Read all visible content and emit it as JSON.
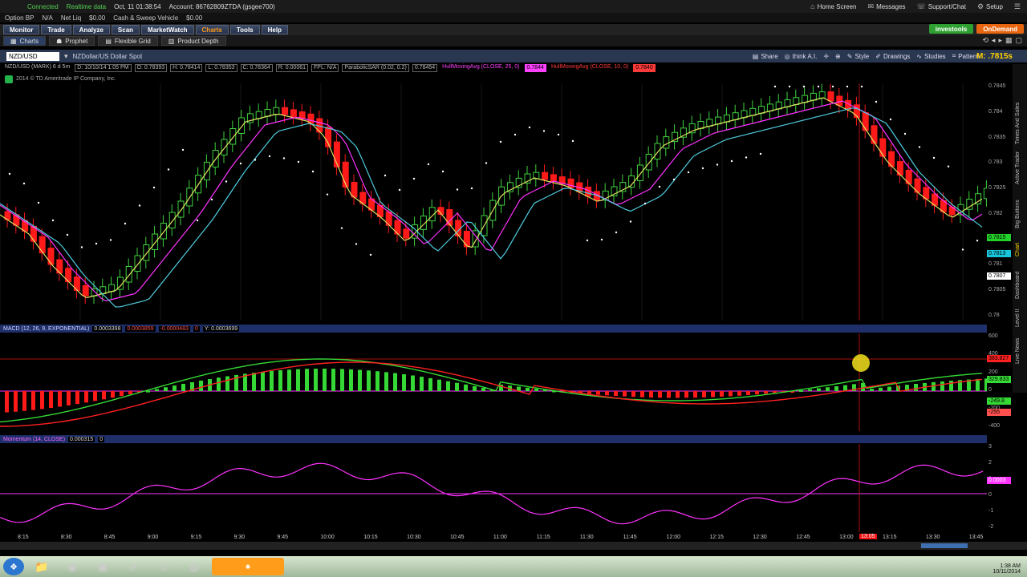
{
  "status": {
    "connected": "Connected",
    "realtime": "Realtime data",
    "datetime": "Oct, 11  01:38:54",
    "account": "Account: 86762809ZTDA (gsgee700)",
    "option_bp": "Option BP",
    "option_bp_val": "N/A",
    "net_liq": "Net Liq",
    "net_liq_val": "$0.00",
    "cash": "Cash & Sweep Vehicle",
    "cash_val": "$0.00"
  },
  "topright": {
    "home": "Home Screen",
    "messages": "Messages",
    "support": "Support/Chat",
    "setup": "Setup"
  },
  "menu": {
    "items": [
      "Monitor",
      "Trade",
      "Analyze",
      "Scan",
      "MarketWatch",
      "Charts",
      "Tools",
      "Help"
    ],
    "brand_left": "investools",
    "brand_right": "OnDemand"
  },
  "subtabs": [
    "Charts",
    "Prophet",
    "Flexible Grid",
    "Product Depth"
  ],
  "chartbar": {
    "symbol": "NZD/USD",
    "desc": "NZDollar/US Dollar Spot",
    "share": "Share",
    "thinkit": "think A.I.",
    "style": "Style",
    "drawings": "Drawings",
    "studies": "Studies",
    "pattern": "Pattern",
    "mark_label": "M: ",
    "mark": ".7815s"
  },
  "legend": {
    "sym": "NZD/USD (MARK) 6 d 5m",
    "date": "D: 10/10/14 1:05 PM",
    "o": "O: 0.78393",
    "h": "H: 0.78414",
    "l": "L: 0.78353",
    "c": "C: 0.78364",
    "r": "R: 0.00061",
    "fpl": "FPL: N/A",
    "psar": "ParabolicSAR (0.02, 0.2)",
    "psar_v": "0.78454",
    "hull1": "HullMovingAvg (CLOSE, 25, 0)",
    "hull1_v": "0.7844",
    "hull2": "HullMovingAvg (CLOSE, 10, 0)",
    "hull2_v": "0.7840"
  },
  "copyright": "2014 © TD Ameritrade IP Company, Inc.",
  "macd": {
    "label": "MACD (12, 26, 9, EXPONENTIAL)",
    "v1": "0.0003398",
    "v2": "0.0003859",
    "v3": "-0.0000483",
    "v4": "0",
    "v5": "Y: 0.0003699"
  },
  "momentum": {
    "label": "Momentum (14, CLOSE)",
    "v1": "0.000315",
    "v2": "0"
  },
  "price_axis": [
    "0.7845",
    "0.784",
    "0.7835",
    "0.783",
    "0.7825",
    "0.782",
    "0.7815",
    "0.781",
    "0.7805",
    "0.78"
  ],
  "price_tags": {
    "green": "0.7815",
    "blue": "0.7813",
    "white": "0.7807"
  },
  "macd_axis": [
    "600",
    "400",
    "200",
    "0",
    "-200",
    "-400"
  ],
  "macd_tags": {
    "red": "383.827",
    "green": "329.833",
    "green2": "-249.8",
    "red2": "-255"
  },
  "mom_axis": [
    "3",
    "2",
    "1",
    "0",
    "-1",
    "-2"
  ],
  "mom_tag": "0.0003",
  "time_axis": [
    "8:15",
    "8:30",
    "8:45",
    "9:00",
    "9:15",
    "9:30",
    "9:45",
    "10:00",
    "10:15",
    "10:30",
    "10:45",
    "11:00",
    "11:15",
    "11:30",
    "11:45",
    "12:00",
    "12:15",
    "12:30",
    "12:45",
    "13:00",
    "13:15",
    "13:30",
    "13:45"
  ],
  "time_highlight": "13:05",
  "rail": [
    "Times And Sales",
    "Active Trader",
    "Big Buttons",
    "Chart",
    "Dashboard",
    "Level II",
    "Live News"
  ],
  "taskbar_clock": {
    "time": "1:38 AM",
    "date": "10/11/2014"
  },
  "colors": {
    "up": "#3fd13f",
    "down": "#ff1a1a",
    "hull25": "#ff33ff",
    "hull10": "#e0e060",
    "avg": "#4ecfe0",
    "psar": "#ffffff",
    "macd": "#35d835",
    "signal": "#ff2020",
    "momentum": "#ff33ff"
  }
}
